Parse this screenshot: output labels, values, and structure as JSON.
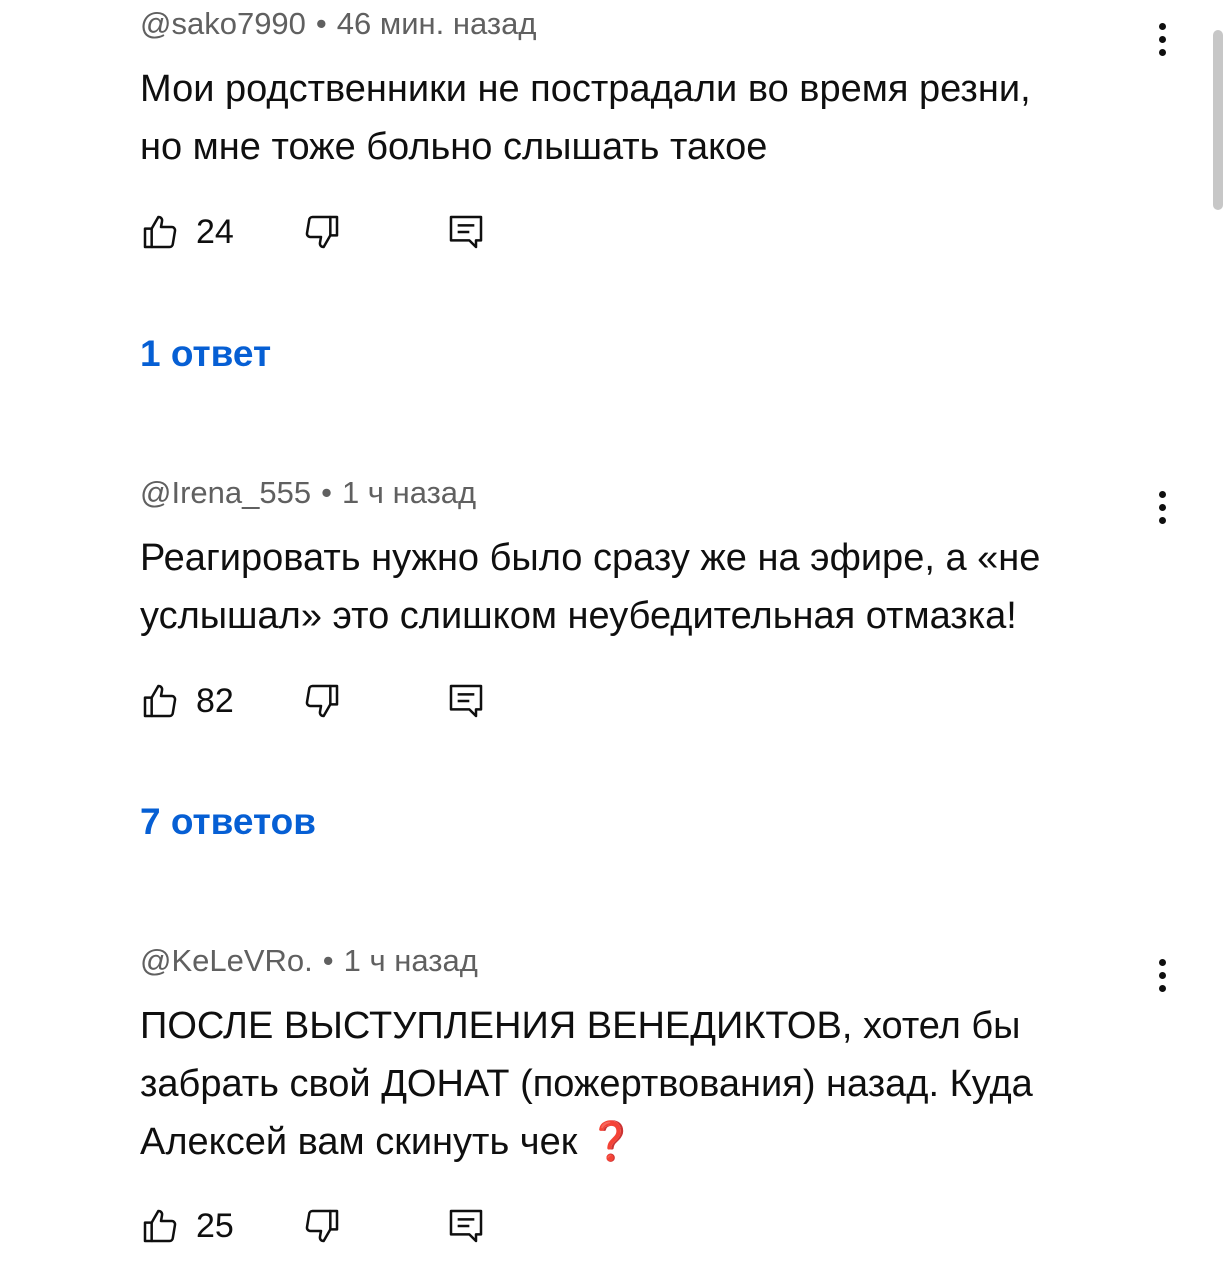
{
  "comments": [
    {
      "author": "@sako7990",
      "separator": "•",
      "time": "46 мин. назад",
      "lines": [
        "Мои родственники не пострадали во время резни,",
        "но мне тоже больно слышать такое"
      ],
      "likes": "24",
      "replies": "1 ответ"
    },
    {
      "author": "@Irena_555",
      "separator": "•",
      "time": "1 ч назад",
      "lines": [
        "Реагировать нужно было сразу же на эфире, а «не",
        "услышал» это слишком неубедительная отмазка!"
      ],
      "likes": "82",
      "replies": "7 ответов"
    },
    {
      "author": "@KeLeVRo.",
      "separator": "•",
      "time": "1 ч назад",
      "lines": [
        "ПОСЛЕ ВЫСТУПЛЕНИЯ ВЕНЕДИКТОВ, хотел бы",
        "забрать свой ДОНАТ (пожертвования) назад. Куда",
        "Алексей вам скинуть чек"
      ],
      "emoji": "❓",
      "likes": "25"
    }
  ],
  "icons": {
    "like": "thumb-up-icon",
    "dislike": "thumb-down-icon",
    "reply": "reply-comment-icon",
    "menu": "more-vertical-icon"
  },
  "colors": {
    "link": "#065fd4",
    "meta": "#606060",
    "text": "#0f0f0f"
  }
}
